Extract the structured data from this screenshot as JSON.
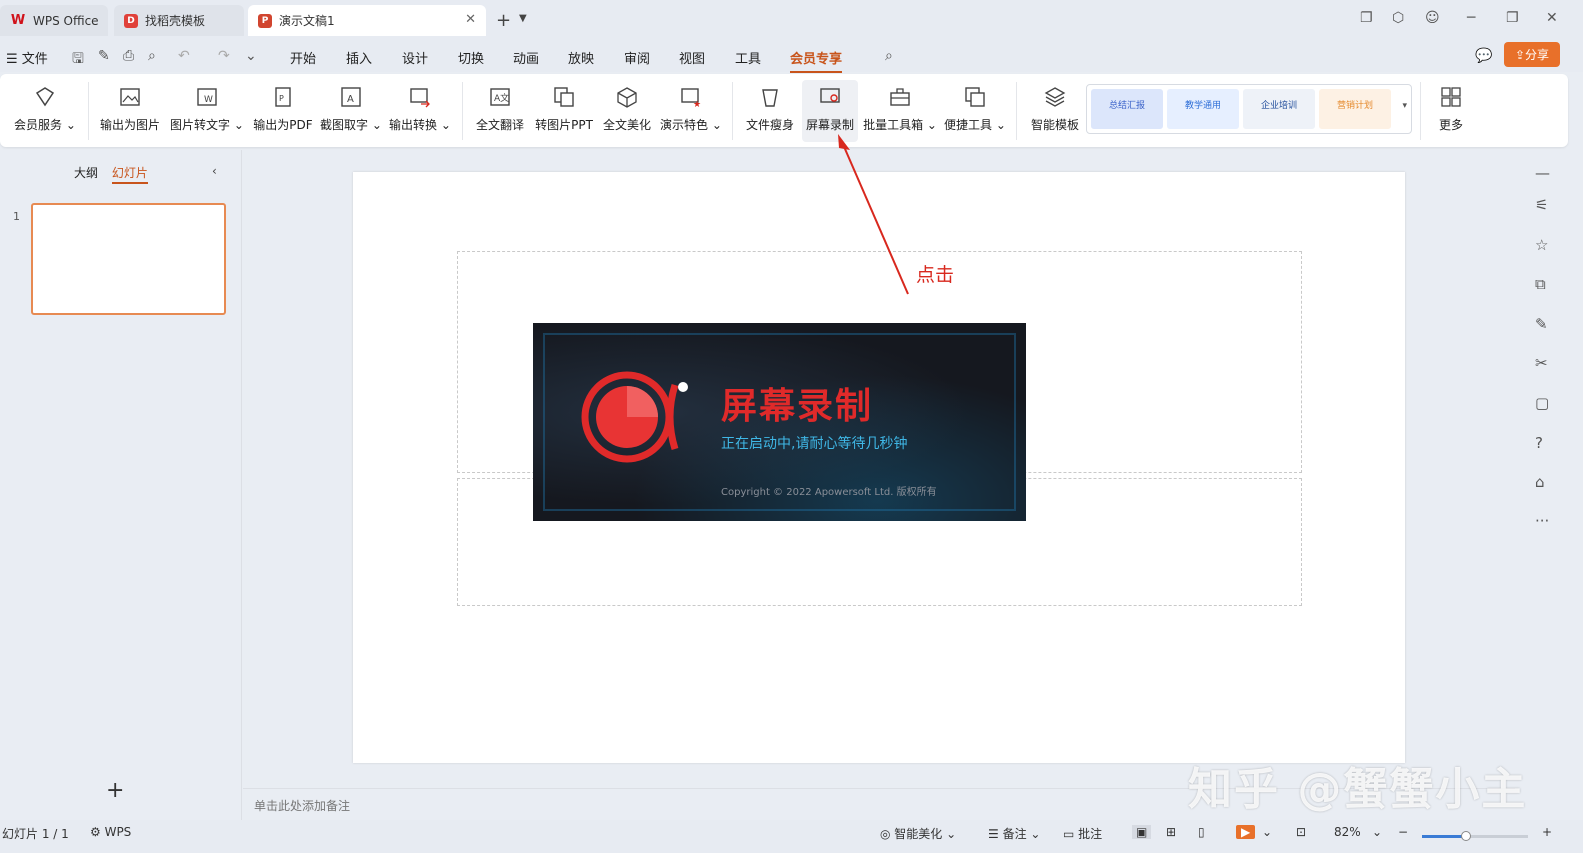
{
  "tabs": {
    "wps": "WPS Office",
    "daoke": "找稻壳模板",
    "doc": "演示文稿1"
  },
  "menu": {
    "file": "文件",
    "items": [
      "开始",
      "插入",
      "设计",
      "切换",
      "动画",
      "放映",
      "审阅",
      "视图",
      "工具",
      "会员专享"
    ],
    "active": "会员专享",
    "share": "分享"
  },
  "ribbon": {
    "vip": "会员服务",
    "export_img": "输出为图片",
    "img2text": "图片转文字",
    "export_pdf": "输出为PDF",
    "screenshot_text": "截图取字",
    "export_convert": "输出转换",
    "translate": "全文翻译",
    "to_ppt": "转图片PPT",
    "beautify": "全文美化",
    "present_feature": "演示特色",
    "slim": "文件瘦身",
    "screen_record": "屏幕录制",
    "batch_tools": "批量工具箱",
    "quick_tools": "便捷工具",
    "smart_template": "智能模板",
    "more": "更多",
    "templates": [
      "总结汇报",
      "教学通用",
      "企业培训",
      "营销计划"
    ]
  },
  "left_panel": {
    "outline": "大纲",
    "slides": "幻灯片",
    "slide_number": "1"
  },
  "annotation": "点击",
  "recorder": {
    "title": "屏幕录制",
    "subtitle": "正在启动中,请耐心等待几秒钟",
    "copyright": "Copyright © 2022 Apowersoft Ltd. 版权所有"
  },
  "notes_placeholder": "单击此处添加备注",
  "status": {
    "slide_info": "幻灯片 1 / 1",
    "wps": "WPS",
    "smart_beautify": "智能美化",
    "notes": "备注",
    "comments": "批注",
    "zoom": "82%"
  },
  "watermark": "知乎 @蟹蟹小主",
  "colors": {
    "accent": "#c8541b",
    "share": "#e8702a",
    "annotation": "#d8281e",
    "recorder_red": "#e02a2a",
    "recorder_blue": "#3fb7e6"
  }
}
